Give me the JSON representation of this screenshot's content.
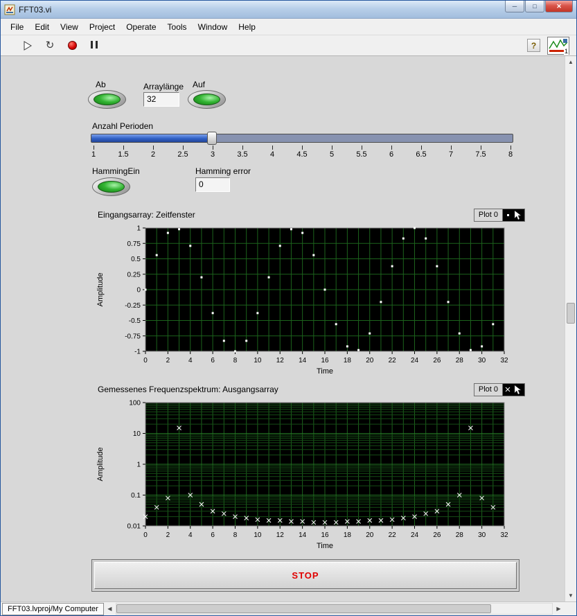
{
  "window": {
    "title": "FFT03.vi"
  },
  "icons": {
    "minimize": "─",
    "maximize": "□",
    "close": "✕",
    "run_continuous": "↻",
    "help": "?",
    "scroll_up": "▲",
    "scroll_down": "▼",
    "scroll_left": "◀",
    "scroll_right": "▶"
  },
  "menubar": {
    "items": [
      "File",
      "Edit",
      "View",
      "Project",
      "Operate",
      "Tools",
      "Window",
      "Help"
    ]
  },
  "toolbar": {
    "vi_number": "1"
  },
  "controls": {
    "ab_label": "Ab",
    "arraylaenge_label": "Arraylänge",
    "arraylaenge_value": "32",
    "auf_label": "Auf",
    "slider_label": "Anzahl Perioden",
    "slider": {
      "min": 1,
      "max": 8,
      "value": 3,
      "tick_labels": [
        "1",
        "1.5",
        "2",
        "2.5",
        "3",
        "3.5",
        "4",
        "4.5",
        "5",
        "5.5",
        "6",
        "6.5",
        "7",
        "7.5",
        "8"
      ]
    },
    "hamming_label": "HammingEin",
    "hamming_error_label": "Hamming error",
    "hamming_error_value": "0"
  },
  "chart_data": [
    {
      "type": "scatter",
      "title": "Eingangsarray: Zeitfenster",
      "legend": "Plot 0",
      "xlabel": "Time",
      "ylabel": "Amplitude",
      "xlim": [
        0,
        32
      ],
      "x_tick_step": 2,
      "ylim": [
        -1,
        1
      ],
      "y_tick_step": 0.25,
      "yscale": "linear",
      "grid": "on",
      "marker": "dot",
      "x": [
        0,
        1,
        2,
        3,
        4,
        5,
        6,
        7,
        8,
        9,
        10,
        11,
        12,
        13,
        14,
        15,
        16,
        17,
        18,
        19,
        20,
        21,
        22,
        23,
        24,
        25,
        26,
        27,
        28,
        29,
        30,
        31
      ],
      "y": [
        0,
        0.56,
        0.92,
        0.98,
        0.71,
        0.2,
        -0.38,
        -0.83,
        -1,
        -0.83,
        -0.38,
        0.2,
        0.71,
        0.98,
        0.92,
        0.56,
        0,
        -0.56,
        -0.92,
        -0.98,
        -0.71,
        -0.2,
        0.38,
        0.83,
        1,
        0.83,
        0.38,
        -0.2,
        -0.71,
        -0.98,
        -0.92,
        -0.56
      ]
    },
    {
      "type": "scatter",
      "title": "Gemessenes Frequenzspektrum: Ausgangsarray",
      "legend": "Plot 0",
      "xlabel": "Time",
      "ylabel": "Amplitude",
      "xlim": [
        0,
        32
      ],
      "x_tick_step": 2,
      "ylim": [
        0.01,
        100
      ],
      "yscale": "log",
      "y_ticks": [
        "100",
        "10",
        "1",
        "0.1",
        "0.01"
      ],
      "grid": "on",
      "marker": "x",
      "x": [
        0,
        1,
        2,
        3,
        4,
        5,
        6,
        7,
        8,
        9,
        10,
        11,
        12,
        13,
        14,
        15,
        16,
        17,
        18,
        19,
        20,
        21,
        22,
        23,
        24,
        25,
        26,
        27,
        28,
        29,
        30,
        31
      ],
      "y": [
        0.02,
        0.04,
        0.08,
        15,
        0.1,
        0.05,
        0.03,
        0.025,
        0.02,
        0.018,
        0.016,
        0.015,
        0.015,
        0.014,
        0.014,
        0.013,
        0.013,
        0.013,
        0.014,
        0.014,
        0.015,
        0.015,
        0.016,
        0.018,
        0.02,
        0.025,
        0.03,
        0.05,
        0.1,
        15,
        0.08,
        0.04
      ]
    }
  ],
  "stop_button": {
    "label": "STOP",
    "color": "#e00000"
  },
  "statusbar": {
    "tab": "FFT03.lvproj/My Computer"
  }
}
